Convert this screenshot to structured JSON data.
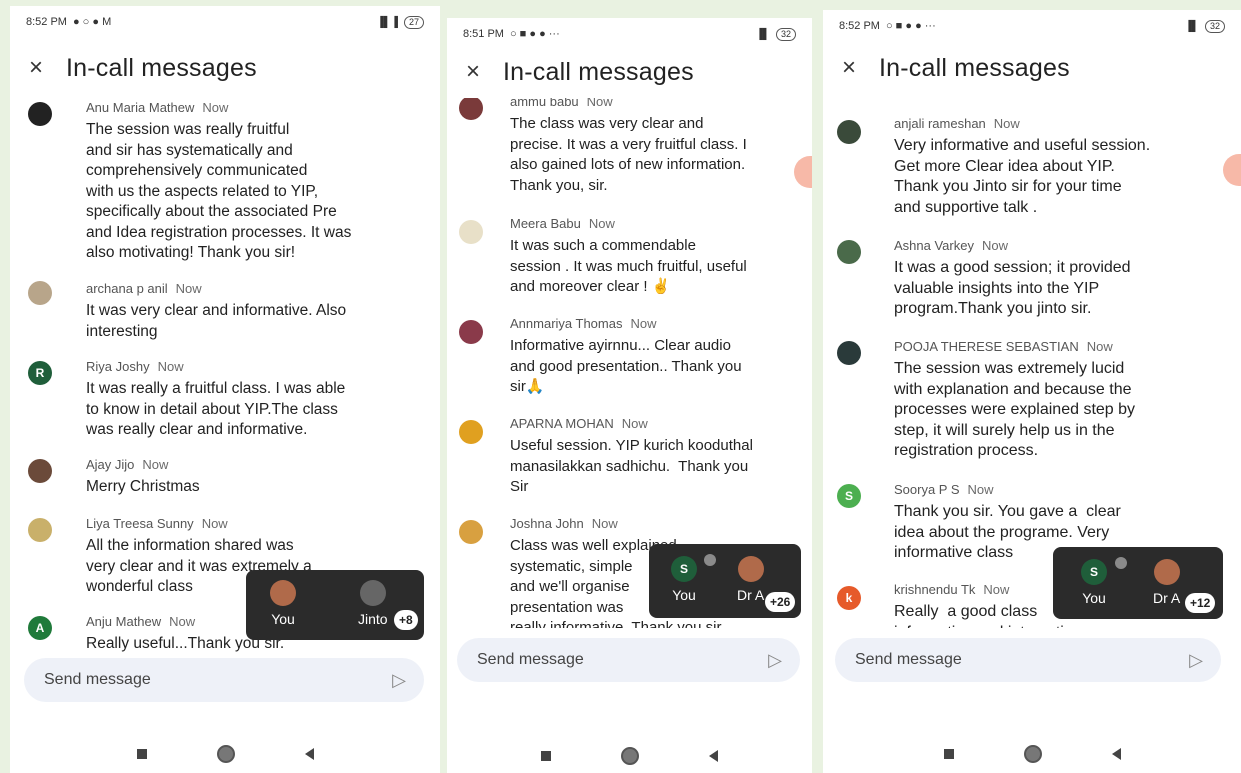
{
  "screens": [
    {
      "status": {
        "time": "8:52 PM",
        "icons": "● ○ ● M",
        "battery": "27",
        "signal": "▐▌▐"
      },
      "header": {
        "title": "In-call messages",
        "close": "×"
      },
      "messages": [
        {
          "name": "Anu Maria Mathew",
          "time": "Now",
          "text": "The session was really fruitful\nand sir has systematically and\ncomprehensively communicated\nwith us the aspects related to YIP,\nspecifically about the associated Pre\nand Idea registration processes. It was\nalso motivating! Thank you sir!",
          "initial": "",
          "color": "#222222"
        },
        {
          "name": "archana p anil",
          "time": "Now",
          "text": "It was very clear and informative. Also\ninteresting",
          "initial": "",
          "color": "#b8a58a"
        },
        {
          "name": "Riya Joshy",
          "time": "Now",
          "text": "It was really a fruitful class. I was able\nto know in detail about YIP.The class\nwas really clear and informative.",
          "initial": "R",
          "color": "#1f5e3a"
        },
        {
          "name": "Ajay Jijo",
          "time": "Now",
          "text": "Merry Christmas",
          "initial": "",
          "color": "#6b4a3a"
        },
        {
          "name": "Liya Treesa Sunny",
          "time": "Now",
          "text": "All the information shared was\nvery clear and it was extremely a\nwonderful class",
          "initial": "",
          "color": "#c9b06a"
        },
        {
          "name": "Anju Mathew",
          "time": "Now",
          "text": "Really useful...Thank you sir.",
          "initial": "A",
          "color": "#1f7a3a"
        }
      ],
      "pip": {
        "you_label": "You",
        "other_label": "Jinto",
        "count": "+8"
      },
      "send": {
        "placeholder": "Send message",
        "icon": "▷"
      }
    },
    {
      "status": {
        "time": "8:51 PM",
        "icons": "○ ■ ● ● ···",
        "battery": "32",
        "signal": "▐▌"
      },
      "header": {
        "title": "In-call messages",
        "close": "×"
      },
      "messages": [
        {
          "name": "ammu babu",
          "time": "Now",
          "text": "The class was very clear and\nprecise. It was a very fruitful class. I\nalso gained lots of new information.\nThank you, sir.",
          "initial": "",
          "color": "#7a3a3a"
        },
        {
          "name": "Meera Babu",
          "time": "Now",
          "text": "It was such a commendable\nsession . It was much fruitful, useful\nand moreover clear ! ✌",
          "initial": "",
          "color": "#e8e0c8"
        },
        {
          "name": "Annmariya Thomas",
          "time": "Now",
          "text": "Informative ayirnnu... Clear audio\nand good presentation.. Thank you\nsir🙏",
          "initial": "",
          "color": "#8a3a4a"
        },
        {
          "name": "APARNA MOHAN",
          "time": "Now",
          "text": "Useful session. YIP kurich kooduthal\nmanasilakkan sadhichu.  Thank you\nSir",
          "initial": "",
          "color": "#e0a020"
        },
        {
          "name": "Joshna John",
          "time": "Now",
          "text": "Class was well explained,\nsystematic, simple\nand we'll organise\npresentation was\nreally informative. Thank you sir",
          "initial": "",
          "color": "#d8a040"
        }
      ],
      "pip": {
        "you_label": "You",
        "other_label": "Dr A",
        "count": "+26",
        "you_initial": "S"
      },
      "send": {
        "placeholder": "Send message",
        "icon": "▷"
      }
    },
    {
      "status": {
        "time": "8:52 PM",
        "icons": "○ ■ ● ● ···",
        "battery": "32",
        "signal": "▐▌"
      },
      "header": {
        "title": "In-call messages",
        "close": "×"
      },
      "messages": [
        {
          "name": "anjali rameshan",
          "time": "Now",
          "text": "Very informative and useful session.\nGet more Clear idea about YIP.\nThank you Jinto sir for your time\nand supportive talk .",
          "initial": "",
          "color": "#3a4a3a"
        },
        {
          "name": "Ashna Varkey",
          "time": "Now",
          "text": "It was a good session; it provided\nvaluable insights into the YIP\nprogram.Thank you jinto sir.",
          "initial": "",
          "color": "#4a6a4a"
        },
        {
          "name": "POOJA THERESE SEBASTIAN",
          "time": "Now",
          "text": "The session was extremely lucid\nwith explanation and because the\nprocesses were explained step by\nstep, it will surely help us in the\nregistration process.",
          "initial": "",
          "color": "#2a3a3a"
        },
        {
          "name": "Soorya P S",
          "time": "Now",
          "text": "Thank you sir. You gave a  clear\nidea about the programe. Very\ninformative class",
          "initial": "S",
          "color": "#4caf50"
        },
        {
          "name": "krishnendu Tk",
          "time": "Now",
          "text": "Really  a good class\ninformative and interactive",
          "initial": "k",
          "color": "#e65a2a"
        }
      ],
      "pip": {
        "you_label": "You",
        "other_label": "Dr A",
        "count": "+12",
        "you_initial": "S"
      },
      "send": {
        "placeholder": "Send message",
        "icon": "▷"
      }
    }
  ]
}
